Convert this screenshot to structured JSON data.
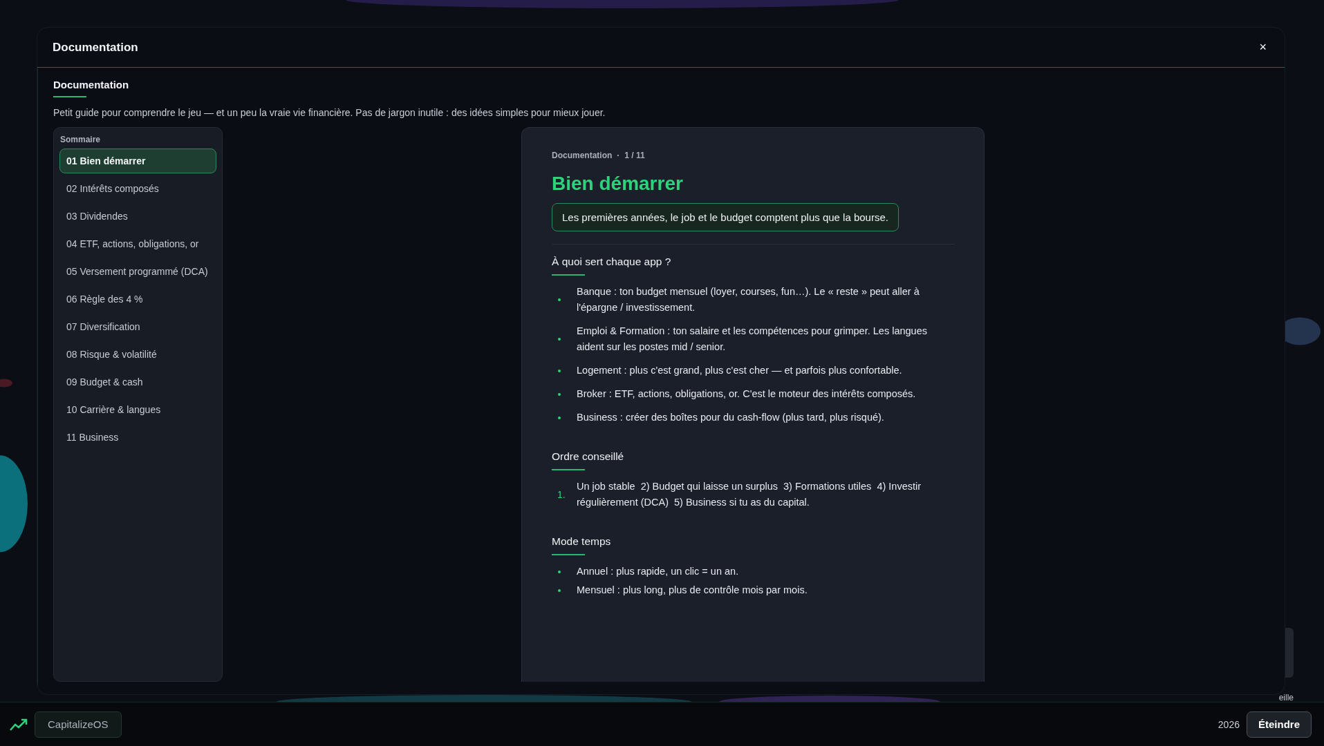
{
  "window": {
    "title": "Documentation",
    "close": "×"
  },
  "page": {
    "heading": "Documentation",
    "intro": "Petit guide pour comprendre le jeu — et un peu la vraie vie financière. Pas de jargon inutile : des idées simples pour mieux jouer."
  },
  "toc": {
    "title": "Sommaire",
    "items": [
      {
        "number": "01",
        "label": "Bien démarrer",
        "selected": true
      },
      {
        "number": "02",
        "label": "Intérêts composés",
        "selected": false
      },
      {
        "number": "03",
        "label": "Dividendes",
        "selected": false
      },
      {
        "number": "04",
        "label": "ETF, actions, obligations, or",
        "selected": false
      },
      {
        "number": "05",
        "label": "Versement programmé (DCA)",
        "selected": false
      },
      {
        "number": "06",
        "label": "Règle des 4 %",
        "selected": false
      },
      {
        "number": "07",
        "label": "Diversification",
        "selected": false
      },
      {
        "number": "08",
        "label": "Risque & volatilité",
        "selected": false
      },
      {
        "number": "09",
        "label": "Budget & cash",
        "selected": false
      },
      {
        "number": "10",
        "label": "Carrière & langues",
        "selected": false
      },
      {
        "number": "11",
        "label": "Business",
        "selected": false
      }
    ]
  },
  "article": {
    "breadcrumb": "Documentation",
    "separator": "·",
    "position": "1 / 11",
    "title": "Bien démarrer",
    "callout": "Les premières années, le job et le budget comptent plus que la bourse.",
    "sections": [
      {
        "heading": "À quoi sert chaque app ?",
        "kind": "bullets",
        "items": [
          {
            "text": "Banque : ton budget mensuel (loyer, courses, fun…). Le « reste » peut aller à l'épargne / investissement."
          },
          {
            "text": "Emploi & Formation : ton salaire et les compétences pour grimper. Les langues aident sur les postes mid / senior."
          },
          {
            "text": "Logement : plus c'est grand, plus c'est cher — et parfois plus confortable."
          },
          {
            "text": "Broker : ETF, actions, obligations, or. C'est le moteur des intérêts composés."
          },
          {
            "text": "Business : créer des boîtes pour du cash-flow (plus tard, plus risqué)."
          }
        ]
      },
      {
        "heading": "Ordre conseillé",
        "kind": "numbered",
        "items": [
          {
            "marker": "1.",
            "text": "Un job stable  2) Budget qui laisse un surplus  3) Formations utiles  4) Investir régulièrement (DCA)  5) Business si tu as du capital."
          }
        ]
      },
      {
        "heading": "Mode temps",
        "kind": "compact",
        "items": [
          {
            "text": "Annuel : plus rapide, un clic = un an."
          },
          {
            "text": "Mensuel : plus long, plus de contrôle mois par mois."
          }
        ]
      }
    ]
  },
  "desktop": {
    "icon_label": "eille"
  },
  "taskbar": {
    "app": "CapitalizeOS",
    "year": "2026",
    "power": "Éteindre"
  }
}
